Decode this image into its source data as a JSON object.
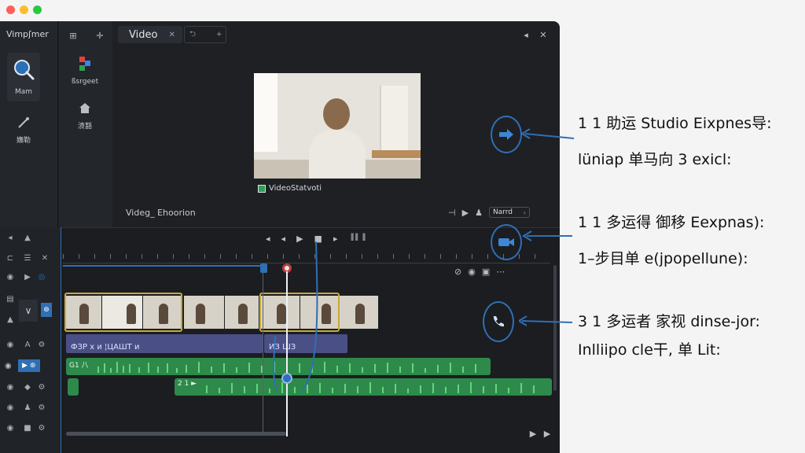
{
  "window": {
    "traffic_colors": [
      "#ff5f57",
      "#febc2e",
      "#28c840"
    ]
  },
  "sidebar": {
    "app_title": "Vimpʃmer",
    "items": [
      {
        "icon": "search-icon",
        "label": "Mam"
      },
      {
        "icon": "wand-icon",
        "label": "嫵勒"
      }
    ]
  },
  "library": {
    "items": [
      {
        "icon": "apps-icon",
        "label": "ßsrgeet"
      },
      {
        "icon": "home-icon",
        "label": "渍豁"
      }
    ]
  },
  "header": {
    "tab_label": "Video",
    "close_glyph": "✕",
    "extra_tab_glyph": "⮌"
  },
  "preview": {
    "caption": "VideoStatvoti",
    "subtitle": "Videg_ Ehoorion",
    "name_field_value": "Narrd"
  },
  "timeline": {
    "playhead_time": "",
    "ruler_label": "▐ ▌▐",
    "title_clip_labels": [
      "ФЗР х и ¦ЦАШТ и",
      "ИЗ ШЗ"
    ],
    "audio_labels": [
      "G1 八",
      "2 1 ►"
    ]
  },
  "annotations": [
    {
      "line1": "1 1 助运 Studio Eixpnes导:",
      "line2": "lüniap 单马向 3 exicl:",
      "icon": "arrow-right-icon"
    },
    {
      "line1": "1 1 多运得 御移 Eexpnas):",
      "line2": "1–步目单 e(jpopellune):",
      "icon": "video-camera-icon"
    },
    {
      "line1": "3 1 多运者 家视 dinse-jor:",
      "line2": "Inlliipo cle干, 单 Lit:",
      "icon": "phone-icon"
    }
  ],
  "colors": {
    "accent_blue": "#2f6fb5",
    "title_track": "#4a4f85",
    "audio_track": "#2e8a4a",
    "clip_highlight": "#c9a93a"
  }
}
